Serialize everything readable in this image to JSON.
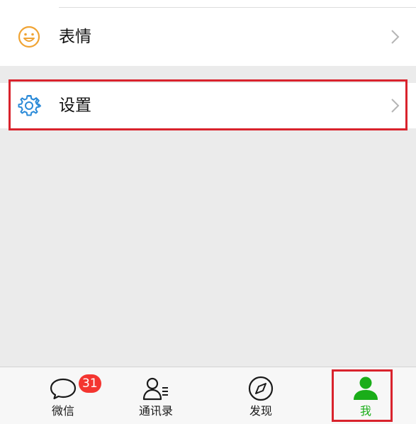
{
  "menu": {
    "sticker": {
      "label": "表情",
      "icon": "smiley-icon"
    },
    "settings": {
      "label": "设置",
      "icon": "gear-icon"
    }
  },
  "tabbar": {
    "chats": {
      "label": "微信",
      "badge": "31",
      "icon": "chat-bubble-icon"
    },
    "contacts": {
      "label": "通讯录",
      "icon": "contacts-icon"
    },
    "discover": {
      "label": "发现",
      "icon": "compass-icon"
    },
    "me": {
      "label": "我",
      "icon": "person-icon",
      "active": true
    }
  },
  "colors": {
    "accent": "#1aad19",
    "badge": "#f43530",
    "highlight": "#d9232d",
    "sticker_icon": "#f0a434",
    "settings_icon": "#2a8ad8"
  }
}
